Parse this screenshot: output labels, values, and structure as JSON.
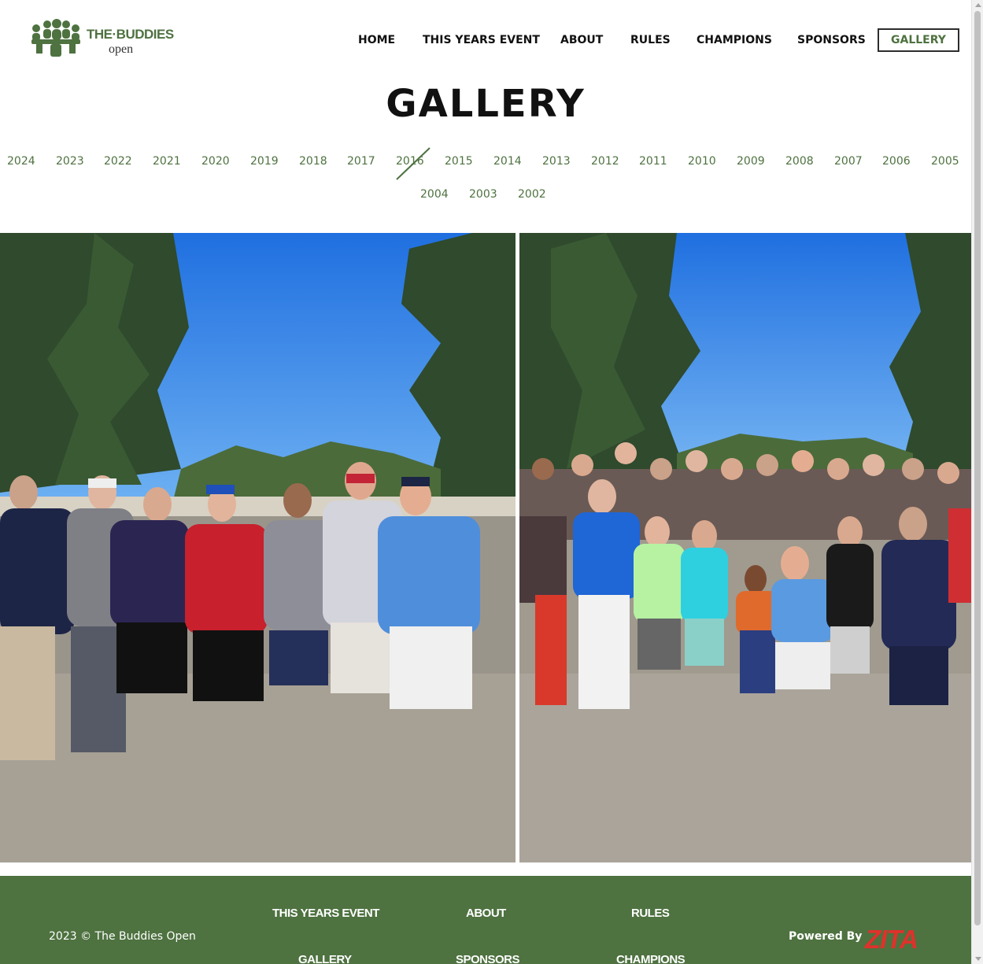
{
  "brand": {
    "title": "THE·BUDDIES",
    "subtitle": "open",
    "color": "#4e7240"
  },
  "nav": {
    "items": [
      {
        "label": "HOME",
        "active": false
      },
      {
        "label": "THIS YEARS EVENT",
        "active": false
      },
      {
        "label": "ABOUT",
        "active": false
      },
      {
        "label": "RULES",
        "active": false
      },
      {
        "label": "CHAMPIONS",
        "active": false
      },
      {
        "label": "SPONSORS",
        "active": false
      },
      {
        "label": "GALLERY",
        "active": true
      }
    ]
  },
  "page": {
    "title": "GALLERY"
  },
  "years": {
    "items": [
      "2024",
      "2023",
      "2022",
      "2021",
      "2020",
      "2019",
      "2018",
      "2017",
      "2016",
      "2015",
      "2014",
      "2013",
      "2012",
      "2011",
      "2010",
      "2009",
      "2008",
      "2007",
      "2006",
      "2005",
      "2004",
      "2003",
      "2002"
    ],
    "selected": "2016"
  },
  "footer": {
    "copyright": "2023 © The Buddies Open",
    "links": [
      "THIS YEARS EVENT",
      "ABOUT",
      "RULES",
      "GALLERY",
      "SPONSORS",
      "CHAMPIONS"
    ],
    "powered_by": "Powered By",
    "powered_brand": "ZITA",
    "background": "#4e7240",
    "powered_brand_color": "#e0312b"
  }
}
